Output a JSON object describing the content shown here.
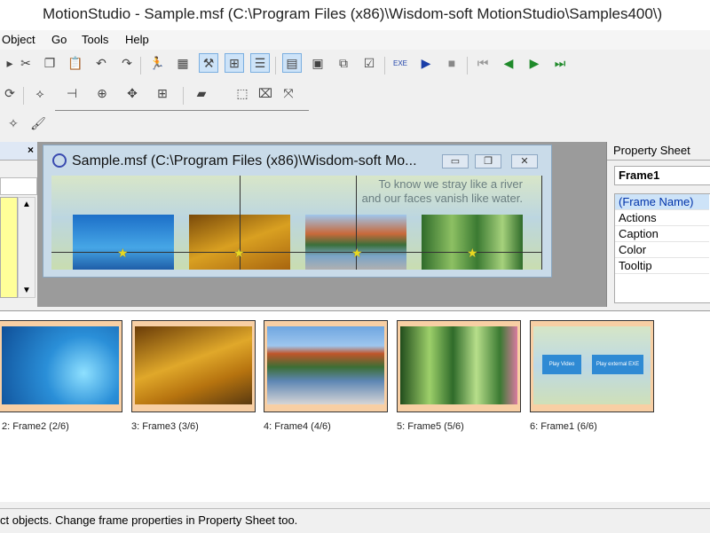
{
  "window": {
    "title": "MotionStudio - Sample.msf (C:\\Program Files (x86)\\Wisdom-soft MotionStudio\\Samples400\\)"
  },
  "menu": [
    "Object",
    "Go",
    "Tools",
    "Help"
  ],
  "document": {
    "title": "Sample.msf (C:\\Program Files (x86)\\Wisdom-soft Mo...",
    "poem_line1": "To know we stray like a river",
    "poem_line2": "and our faces vanish like water."
  },
  "left_panel": {
    "close_glyph": "×"
  },
  "property_sheet": {
    "title": "Property Sheet",
    "frame_name": "Frame1",
    "properties": [
      "(Frame Name)",
      "Actions",
      "Caption",
      "Color",
      "Tooltip"
    ],
    "selected_index": 0
  },
  "frames": [
    {
      "label": "2: Frame2 (2/6)",
      "theme": "underwater"
    },
    {
      "label": "3: Frame3 (3/6)",
      "theme": "autumn"
    },
    {
      "label": "4: Frame4 (4/6)",
      "theme": "lake"
    },
    {
      "label": "5: Frame5 (5/6)",
      "theme": "forest"
    },
    {
      "label": "6: Frame1 (6/6)",
      "theme": "menu",
      "buttons": [
        "Play Video",
        "Play external EXE"
      ]
    }
  ],
  "status": {
    "text": "ct objects. Change frame properties in Property Sheet too."
  },
  "colors": {
    "accent": "#2f8ad4",
    "selection": "#cde3f8",
    "frame_border": "#f8cfa4"
  }
}
